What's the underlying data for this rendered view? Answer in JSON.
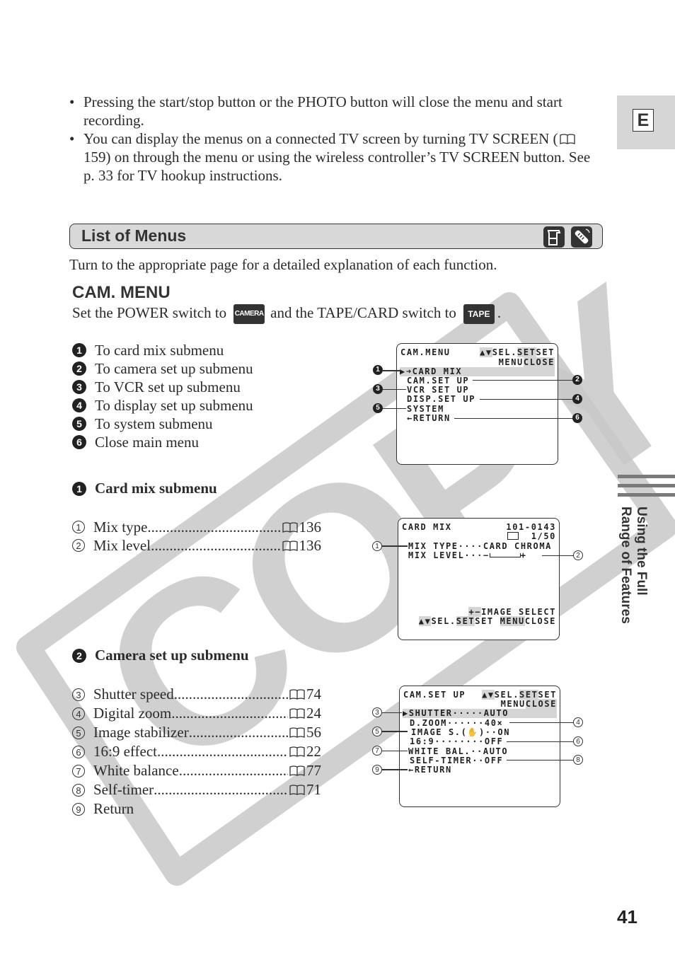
{
  "page": {
    "lang_tab": "E",
    "page_number": "41",
    "side_tab": [
      "Using the Full",
      "Range of Features"
    ],
    "watermark": "COPY"
  },
  "bullets": [
    "Pressing the start/stop button or the PHOTO button will close the menu and start recording.",
    {
      "before": "You can display the menus on a connected TV screen by turning TV SCREEN (",
      "ref": "159",
      "after": ") on through the menu or using the wireless controller’s TV SCREEN button. See p. 33 for TV hookup instructions."
    }
  ],
  "section": {
    "title": "List of Menus",
    "icons": [
      "camcorder-icon",
      "remote-control-icon"
    ],
    "intro": "Turn to the appropriate page for a detailed explanation of each function."
  },
  "cam_menu": {
    "title": "CAM. MENU",
    "power_text_1": "Set the POWER switch to",
    "power_badge": "CAMERA",
    "power_text_2": "and the TAPE/CARD switch to",
    "tape_badge": "TAPE",
    "power_text_3": ".",
    "items": [
      {
        "num": "1",
        "label": "To card mix submenu"
      },
      {
        "num": "2",
        "label": "To camera set up submenu"
      },
      {
        "num": "3",
        "label": "To VCR set up submenu"
      },
      {
        "num": "4",
        "label": "To display set up submenu"
      },
      {
        "num": "5",
        "label": "To system submenu"
      },
      {
        "num": "6",
        "label": "Close main menu"
      }
    ],
    "screen": {
      "title": "CAM.MENU",
      "nav_arrows": "▲▼",
      "nav_sel": "SEL.",
      "nav_set": "SET",
      "nav_set2": "SET",
      "nav_menu": "MENU",
      "nav_close": "CLOSE",
      "lines": [
        "▶➜CARD MIX",
        "CAM.SET UP",
        "VCR SET UP",
        "DISP.SET UP",
        "SYSTEM",
        "←RETURN"
      ],
      "callouts": [
        "1",
        "2",
        "3",
        "4",
        "5",
        "6"
      ]
    }
  },
  "card_mix": {
    "num": "1",
    "title": "Card mix submenu",
    "items": [
      {
        "num": "1",
        "label": "Mix type",
        "page": "136"
      },
      {
        "num": "2",
        "label": "Mix level",
        "page": "136"
      }
    ],
    "screen": {
      "title": "CARD MIX",
      "file_no": "101-0143",
      "count": "1/50",
      "mix_type_label": "MIX TYPE····",
      "mix_type_value": "CARD CHROMA",
      "mix_level_label": "MIX LEVEL···",
      "mix_level_minus": "−",
      "mix_level_plus": "+",
      "image_select_keys": "+−",
      "image_select": "IMAGE SELECT",
      "footer_arrows": "▲▼",
      "footer_sel": "SEL.",
      "footer_set": "SET",
      "footer_set_menu": "SET ",
      "footer_menu": "MENU",
      "footer_close": "CLOSE",
      "callouts": [
        "1",
        "2"
      ]
    }
  },
  "camera_setup": {
    "num": "2",
    "title": "Camera set up submenu",
    "items": [
      {
        "num": "3",
        "label": "Shutter speed",
        "page": "74"
      },
      {
        "num": "4",
        "label": "Digital zoom",
        "page": "24"
      },
      {
        "num": "5",
        "label": "Image stabilizer",
        "page": "56"
      },
      {
        "num": "6",
        "label": "16:9 effect",
        "page": "22"
      },
      {
        "num": "7",
        "label": "White balance",
        "page": "77"
      },
      {
        "num": "8",
        "label": "Self-timer",
        "page": "71"
      },
      {
        "num": "9",
        "label": "Return",
        "page": ""
      }
    ],
    "screen": {
      "title": "CAM.SET UP",
      "nav_arrows": "▲▼",
      "nav_sel": "SEL.",
      "nav_set": "SET",
      "nav_set2": "SET",
      "nav_menu": "MENU",
      "nav_close": "CLOSE",
      "lines": [
        "▶SHUTTER·····AUTO",
        "D.ZOOM······40×",
        "IMAGE S.(✋)··ON",
        "16:9········OFF",
        "WHITE BAL.··AUTO",
        "SELF-TIMER··OFF",
        "←RETURN"
      ],
      "callouts": [
        "3",
        "4",
        "5",
        "6",
        "7",
        "8",
        "9"
      ]
    }
  }
}
